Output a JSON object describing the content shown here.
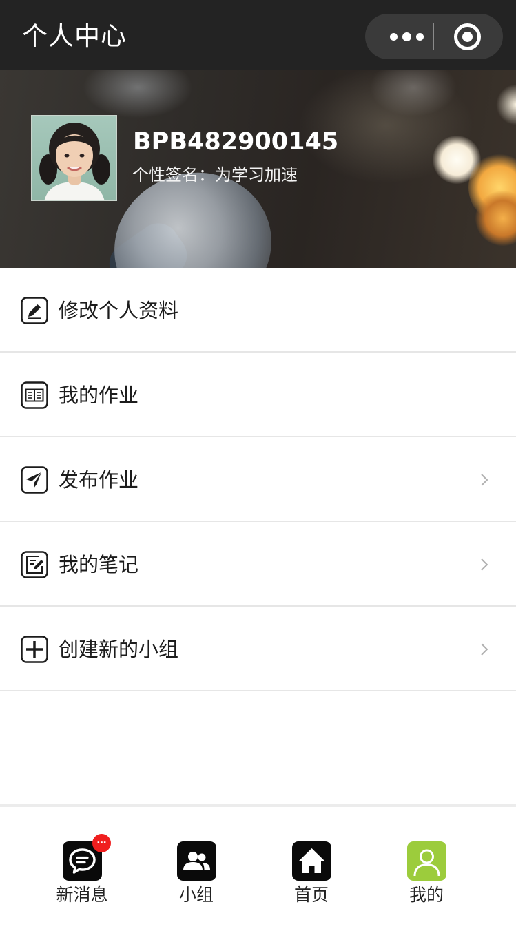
{
  "navbar": {
    "title": "个人中心",
    "more_icon": "more-dots-icon",
    "close_icon": "target-circle-icon"
  },
  "profile": {
    "username": "BPB482900145",
    "signature": "个性签名：为学习加速"
  },
  "menu": {
    "items": [
      {
        "label": "修改个人资料",
        "icon": "edit-pencil-icon",
        "has_chevron": false
      },
      {
        "label": "我的作业",
        "icon": "open-book-icon",
        "has_chevron": false
      },
      {
        "label": "发布作业",
        "icon": "paper-plane-icon",
        "has_chevron": true
      },
      {
        "label": "我的笔记",
        "icon": "note-edit-icon",
        "has_chevron": true
      },
      {
        "label": "创建新的小组",
        "icon": "plus-square-icon",
        "has_chevron": true
      }
    ]
  },
  "tabbar": {
    "tabs": [
      {
        "label": "新消息",
        "icon": "chat-bubble-icon",
        "badge": "…"
      },
      {
        "label": "小组",
        "icon": "group-icon"
      },
      {
        "label": "首页",
        "icon": "home-icon"
      },
      {
        "label": "我的",
        "icon": "user-icon",
        "active": true
      }
    ]
  },
  "colors": {
    "navbar_bg": "#232323",
    "active_tab": "#9ccc3c",
    "badge": "#f01e1e",
    "divider": "#e6e6e6"
  }
}
